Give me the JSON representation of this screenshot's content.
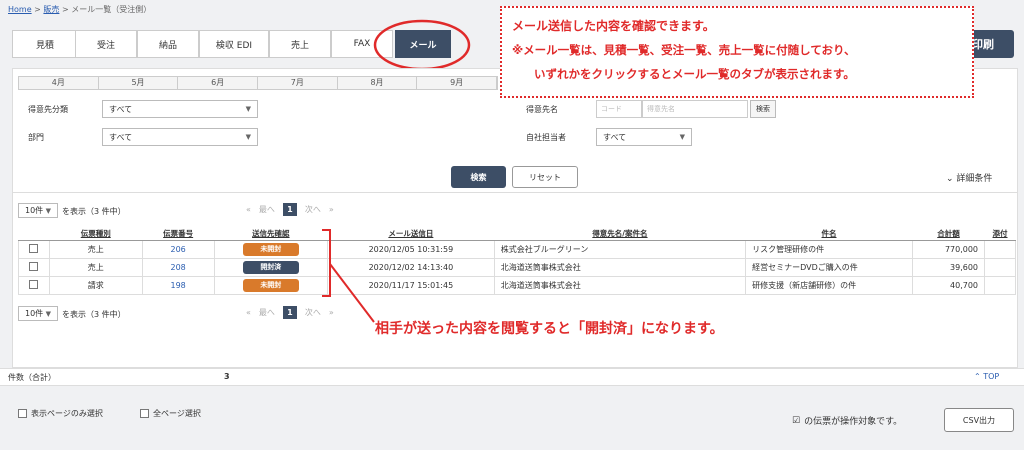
{
  "breadcrumb": {
    "home": "Home",
    "sales": "販売",
    "current": "メール一覧（受注側）"
  },
  "tabs": [
    {
      "label": "見積"
    },
    {
      "label": "受注"
    },
    {
      "label": "納品"
    },
    {
      "label": "検収 EDI"
    },
    {
      "label": "売上"
    },
    {
      "label": "FAX"
    },
    {
      "label": "メール"
    }
  ],
  "print_label": "印刷",
  "months": [
    "4月",
    "5月",
    "6月",
    "7月",
    "8月",
    "9月"
  ],
  "filters": {
    "customer_category_label": "得意先分類",
    "customer_category_value": "すべて",
    "department_label": "部門",
    "department_value": "すべて",
    "customer_name_label": "得意先名",
    "code_placeholder": "コード",
    "customer_placeholder": "得意先名",
    "lookup_label": "検索",
    "staff_label": "自社担当者",
    "staff_value": "すべて"
  },
  "search_label": "検索",
  "reset_label": "リセット",
  "detail_label": "詳細条件",
  "page_size": "10件",
  "page_size_suffix": "を表示（3 件中）",
  "pager": {
    "first": "«",
    "prev": "最へ",
    "current": "1",
    "next": "次へ",
    "last": "»"
  },
  "columns": [
    "伝票種別",
    "伝票番号",
    "送信先確認",
    "メール送信日",
    "得意先名/案件名",
    "件名",
    "合計額",
    "添付"
  ],
  "rows": [
    {
      "type": "売上",
      "number": "206",
      "status": "未開封",
      "status_kind": "unopened",
      "sent": "2020/12/05 10:31:59",
      "customer": "株式会社ブルーグリーン",
      "subject": "リスク管理研修の件",
      "total": "770,000"
    },
    {
      "type": "売上",
      "number": "208",
      "status": "開封済",
      "status_kind": "opened",
      "sent": "2020/12/02 14:13:40",
      "customer": "北海道送筒事株式会社",
      "subject": "経営セミナーDVDご購入の件",
      "total": "39,600"
    },
    {
      "type": "請求",
      "number": "198",
      "status": "未開封",
      "status_kind": "unopened",
      "sent": "2020/11/17 15:01:45",
      "customer": "北海道送筒事株式会社",
      "subject": "研修支援（新店舗研修）の件",
      "total": "40,700"
    }
  ],
  "summary": {
    "count_label": "件数（合計）",
    "count_value": "3",
    "top_label": "TOP"
  },
  "footer": {
    "page_select_label": "表示ページのみ選択",
    "all_select_label": "全ページ選択",
    "target_note": "の伝票が操作対象です。",
    "csv_label": "CSV出力"
  },
  "callout": {
    "line1": "メール送信した内容を確認できます。",
    "line2": "※メール一覧は、見積一覧、受注一覧、売上一覧に付随しており、",
    "line3": "いずれかをクリックするとメール一覧のタブが表示されます。"
  },
  "annotation": "相手が送った内容を閲覧すると「開封済」になります。",
  "colors": {
    "accent": "#3d4e66",
    "unopened": "#d97a2b",
    "annotation": "#e02a2a"
  }
}
